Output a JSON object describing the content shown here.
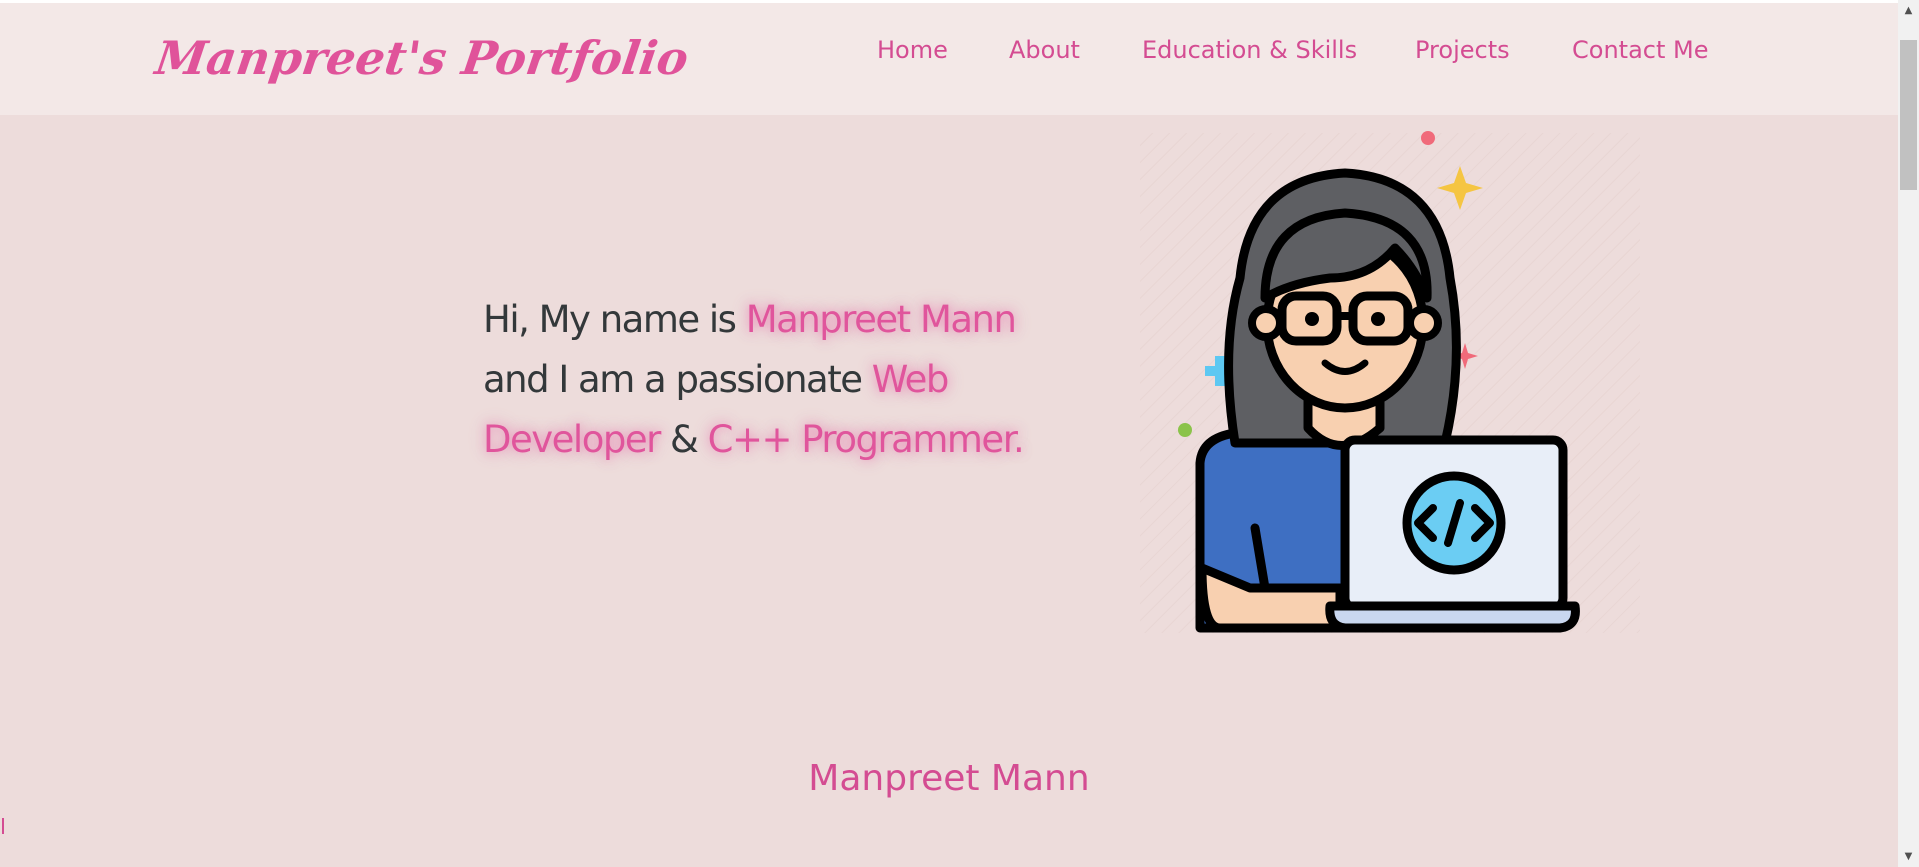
{
  "header": {
    "logo": "Manpreet's Portfolio",
    "nav": [
      {
        "label": "Home"
      },
      {
        "label": "About"
      },
      {
        "label": "Education & Skills"
      },
      {
        "label": "Projects"
      },
      {
        "label": "Contact Me"
      }
    ]
  },
  "hero": {
    "intro": "Hi, My name is ",
    "name": "Manpreet Mann",
    "mid": "and I am a passionate ",
    "role1": "Web Developer",
    "amp": " & ",
    "role2": "C++ Programmer.",
    "illustration_icon": "developer-girl-laptop-illustration"
  },
  "section": {
    "heading": "Manpreet Mann"
  },
  "scrollbar": {
    "up_icon": "▲",
    "down_icon": "▼"
  },
  "colors": {
    "background": "#eddcdb",
    "header_bg": "#f3e8e7",
    "accent": "#e0559c",
    "text": "#33383a"
  }
}
